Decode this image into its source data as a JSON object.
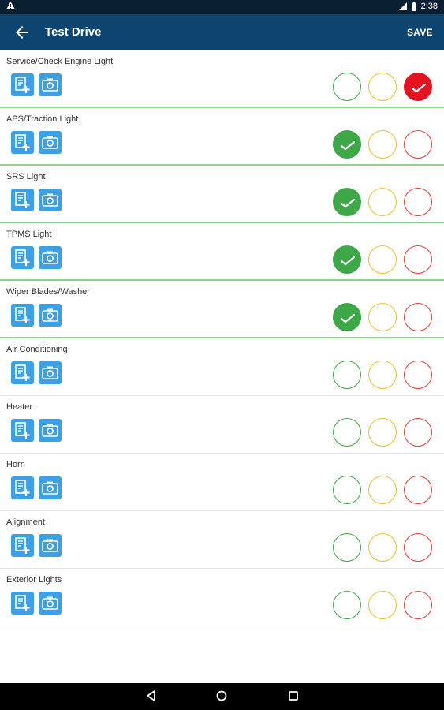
{
  "status_bar": {
    "time": "2:38",
    "icons": [
      "warning-icon",
      "signal-icon",
      "battery-icon"
    ]
  },
  "app_bar": {
    "title": "Test Drive",
    "save_label": "SAVE",
    "back_icon": "arrow-back-icon"
  },
  "colors": {
    "primary": "#0e4470",
    "pass": "#3ea849",
    "warning": "#f0bd2e",
    "fail": "#e53b3b",
    "tool": "#3ca0e6"
  },
  "items": [
    {
      "label": "Service/Check Engine Light",
      "status": "fail"
    },
    {
      "label": "ABS/Traction Light",
      "status": "pass"
    },
    {
      "label": "SRS Light",
      "status": "pass"
    },
    {
      "label": "TPMS Light",
      "status": "pass"
    },
    {
      "label": "Wiper Blades/Washer",
      "status": "pass"
    },
    {
      "label": "Air Conditioning",
      "status": "none"
    },
    {
      "label": "Heater",
      "status": "none"
    },
    {
      "label": "Horn",
      "status": "none"
    },
    {
      "label": "Alignment",
      "status": "none"
    },
    {
      "label": "Exterior Lights",
      "status": "none"
    }
  ],
  "nav_bar": {
    "icons": [
      "back-triangle-icon",
      "home-circle-icon",
      "recents-square-icon"
    ]
  }
}
